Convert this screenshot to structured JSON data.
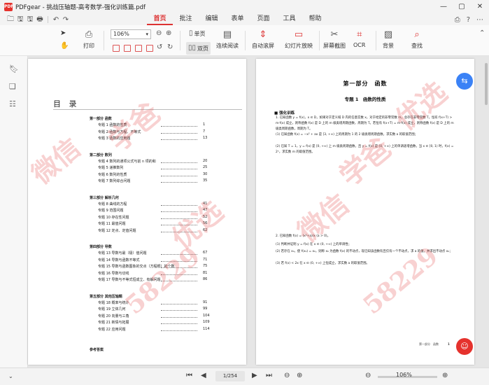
{
  "window": {
    "app_logo": "PDF",
    "title": "PDFgear - 挑战压轴题-高考数学-强化训练篇.pdf",
    "controls": [
      "—",
      "▢",
      "✕"
    ]
  },
  "quick_access": [
    "🗀",
    "🖫",
    "🖫",
    "🖶",
    "↶",
    "↷"
  ],
  "menu": {
    "tabs": [
      "首页",
      "批注",
      "编辑",
      "表单",
      "页面",
      "工具",
      "帮助"
    ],
    "active_tab": "首页",
    "right_icons": [
      "⎙",
      "?",
      "⋯"
    ]
  },
  "toolbar": {
    "print_label": "打印",
    "zoom_value": "106%",
    "single_page_label": "单页",
    "double_page_label": "双页",
    "continuous_label": "连续阅读",
    "auto_scroll_label": "自动滚屏",
    "slideshow_label": "幻灯片放映",
    "screenshot_label": "屏幕截图",
    "ocr_label": "OCR",
    "background_label": "背景",
    "find_label": "查找"
  },
  "sidebar_icons": [
    "bookmark-icon",
    "pages-icon",
    "comment-icon"
  ],
  "toc": {
    "title": "目 录",
    "parts": [
      {
        "label": "第一部分 函数",
        "items": [
          {
            "label": "专题 1 函数的性质",
            "page": "1"
          },
          {
            "label": "专题 2 函数与方程、不等式",
            "page": "7"
          },
          {
            "label": "专题 3 函数的应用题",
            "page": "13"
          }
        ]
      },
      {
        "label": "第二部分 数列",
        "items": [
          {
            "label": "专题 4 数列的通项公式与前 n 项的和",
            "page": "20"
          },
          {
            "label": "专题 5 递推数列",
            "page": "25"
          },
          {
            "label": "专题 6 数列的性质",
            "page": "30"
          },
          {
            "label": "专题 7 数列综合问题",
            "page": "35"
          }
        ]
      },
      {
        "label": "第三部分 解析几何",
        "items": [
          {
            "label": "专题 8 曲线的方程",
            "page": "41"
          },
          {
            "label": "专题 9 范围问题",
            "page": "47"
          },
          {
            "label": "专题 10 存在性问题",
            "page": "52"
          },
          {
            "label": "专题 11 最值问题",
            "page": "56"
          },
          {
            "label": "专题 12 定点、定值问题",
            "page": "62"
          }
        ]
      },
      {
        "label": "第四部分 导数",
        "items": [
          {
            "label": "专题 13 导数与最（极）值问题",
            "page": "67"
          },
          {
            "label": "专题 14 导数与函数不等式",
            "page": "71"
          },
          {
            "label": "专题 15 导数与函数图象的交点（方程根）的个数",
            "page": "75"
          },
          {
            "label": "专题 16 导数与切线",
            "page": "81"
          },
          {
            "label": "专题 17 导数与不等式恒成立、有解问题",
            "page": "86"
          }
        ]
      },
      {
        "label": "第五部分 其他压轴题",
        "items": [
          {
            "label": "专题 18 概率与统计",
            "page": "91"
          },
          {
            "label": "专题 19 立体几何",
            "page": "99"
          },
          {
            "label": "专题 20 向量与三角",
            "page": "104"
          },
          {
            "label": "专题 21 新情与拓展",
            "page": "109"
          },
          {
            "label": "专题 22 应用问题",
            "page": "114"
          }
        ]
      }
    ],
    "answers_label": "参考答案"
  },
  "page2": {
    "part_title": "第一部分　函数",
    "topic_title": "专题 1　函数的性质",
    "section": "■ 强化训练",
    "q1": "1. 已知函数 y = f(x)，x ∈ D，如果对于定义域 D 内的任意实数 x，对于给定的非零常数 m，总存在非零常数 T，恒有 f(x+T) > m·f(x) 成立，则称函数 f(x) 是 D 上的 m 级类增周期函数，周期为 T。若恒有 f(x+T) = m·f(x) 成立，则称函数 f(x) 是 D 上的 m 级类周期函数，周期为 T。",
    "q1_1": "(1) 已知函数 f(x) = −x² + ax 是 [3, +∞) 上的周期为 1 的 2 级类增周期函数，求实数 a 的取值范围；",
    "q1_2": "(2) 已知 T = 1，y = f(x) 是 [0, +∞) 上 m 级类周期函数，且 y = f(x) 是 [0, +∞) 上的单调递增函数，当 x ∈ [0, 1) 时，f(x) = 2ˣ，求实数 m 的取值范围。",
    "q2": "2. 已知函数 f(x) = (x²+a)/x (a > 0)。",
    "q2_1": "(1) 判断并证明 y = f(x) 在 x ∈ (0, +∞) 上的单调性；",
    "q2_2": "(2) 若存在 x₀，使 f(x₀) = x₀，则称 x₀ 为函数 f(x) 的不动点，现已知该函数有且仅有一个不动点，求 a 的值，并求出不动点 x₀；",
    "q2_3": "(3) 若 f(x) < 2x 在 x ∈ (0, +∞) 上恒成立，求实数 a 的取值范围。",
    "footer": "第一部分　函数",
    "page_num": "1"
  },
  "watermarks": [
    "微信",
    "学爸",
    "优选",
    "58229",
    "微信",
    "学爸",
    "58229",
    "优选"
  ],
  "status": {
    "current_page": "1",
    "total_pages": "/254",
    "zoom": "106%"
  },
  "colors": {
    "accent": "#d33",
    "fab_blue": "#3b82f6",
    "fab_red": "#e5322d"
  }
}
